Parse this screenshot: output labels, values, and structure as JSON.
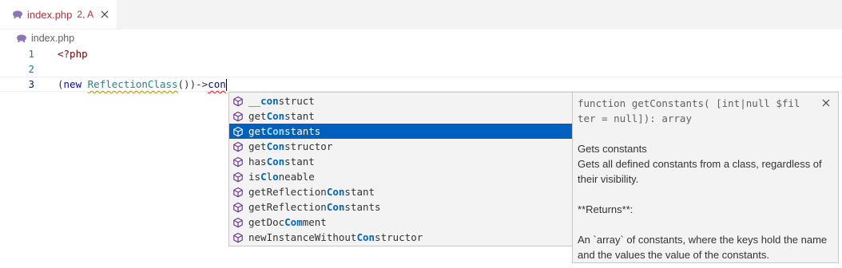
{
  "tab": {
    "label": "index.php",
    "status": "2, A",
    "icon": "php-elephant-icon",
    "label_color": "#b5323c"
  },
  "breadcrumb": {
    "file": "index.php"
  },
  "editor": {
    "lines": [
      {
        "number": "1",
        "code": "<?php"
      },
      {
        "number": "2",
        "code": ""
      },
      {
        "number": "3",
        "new_kw": "new",
        "class_name": "ReflectionClass",
        "call": "())->",
        "typed": "con"
      }
    ],
    "open_paren": "("
  },
  "suggestions": {
    "items": [
      {
        "pre": "__",
        "match": "con",
        "post": "struct"
      },
      {
        "pre": "get",
        "match": "Con",
        "post": "stant"
      },
      {
        "pre": "get",
        "match": "Con",
        "post": "stants"
      },
      {
        "pre": "get",
        "match": "Con",
        "post": "structor"
      },
      {
        "pre": "has",
        "match": "Con",
        "post": "stant"
      },
      {
        "pre": "is",
        "match": "C",
        "mid": "l",
        "match2": "o",
        "post": "neable"
      },
      {
        "pre": "getReflection",
        "match": "Con",
        "post": "stant"
      },
      {
        "pre": "getReflection",
        "match": "Con",
        "post": "stants"
      },
      {
        "pre": "getDoc",
        "match": "Com",
        "post": "ment"
      },
      {
        "pre": "newInstanceWithout",
        "match": "Con",
        "post": "structor"
      }
    ],
    "selected_index": 2,
    "icon": "method-cube-icon",
    "selection_color": "#0060c0"
  },
  "details": {
    "signature_line1": "function getConstants( [int|null $fil",
    "signature_line2": "ter = null]): array",
    "summary": "Gets constants",
    "description": "Gets all defined constants from a class, regardless of their visibility.",
    "returns_heading": "**Returns**:",
    "returns_text": "An `array` of constants, where the keys hold the name and the values the value of the constants."
  }
}
